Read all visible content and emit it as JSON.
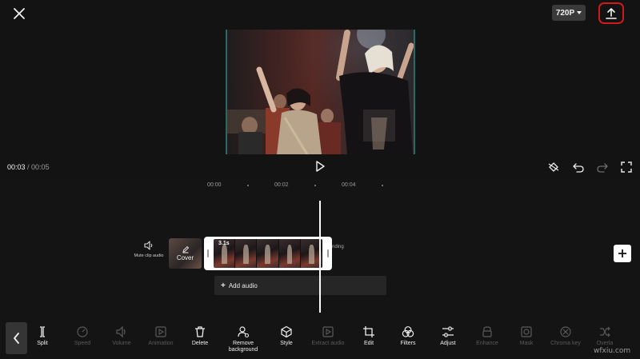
{
  "header": {
    "resolution": "720P"
  },
  "player": {
    "current_time": "00:03",
    "separator": " / ",
    "total_time": "00:05"
  },
  "timeline": {
    "ruler": [
      "00:00",
      "00:02",
      "00:04"
    ],
    "mute_label": "Mute clip audio",
    "cover_label": "Cover",
    "clip_duration": "3.1s",
    "ending_label": "nding",
    "add_audio_label": "Add audio"
  },
  "toolbar": {
    "tools": [
      {
        "label": "Split",
        "enabled": true,
        "icon": "split-icon"
      },
      {
        "label": "Speed",
        "enabled": false,
        "icon": "speed-icon"
      },
      {
        "label": "Volume",
        "enabled": false,
        "icon": "volume-icon"
      },
      {
        "label": "Animation",
        "enabled": false,
        "icon": "animation-icon"
      },
      {
        "label": "Delete",
        "enabled": true,
        "icon": "delete-icon"
      },
      {
        "label": "Remove background",
        "enabled": true,
        "icon": "remove-background-icon"
      },
      {
        "label": "Style",
        "enabled": true,
        "icon": "style-icon"
      },
      {
        "label": "Extract audio",
        "enabled": false,
        "icon": "extract-audio-icon"
      },
      {
        "label": "Edit",
        "enabled": true,
        "icon": "crop-icon"
      },
      {
        "label": "Filters",
        "enabled": true,
        "icon": "filters-icon"
      },
      {
        "label": "Adjust",
        "enabled": true,
        "icon": "adjust-icon"
      },
      {
        "label": "Enhance",
        "enabled": false,
        "icon": "enhance-icon"
      },
      {
        "label": "Mask",
        "enabled": false,
        "icon": "mask-icon"
      },
      {
        "label": "Chroma key",
        "enabled": false,
        "icon": "chroma-key-icon"
      },
      {
        "label": "Overla",
        "enabled": false,
        "icon": "overlay-icon"
      }
    ]
  },
  "watermark": "wfxiu.com",
  "colors": {
    "background": "#141414",
    "export_highlight": "#d01a1a",
    "clip_border": "#ffffff",
    "preview_edge": "#2a6a66"
  }
}
